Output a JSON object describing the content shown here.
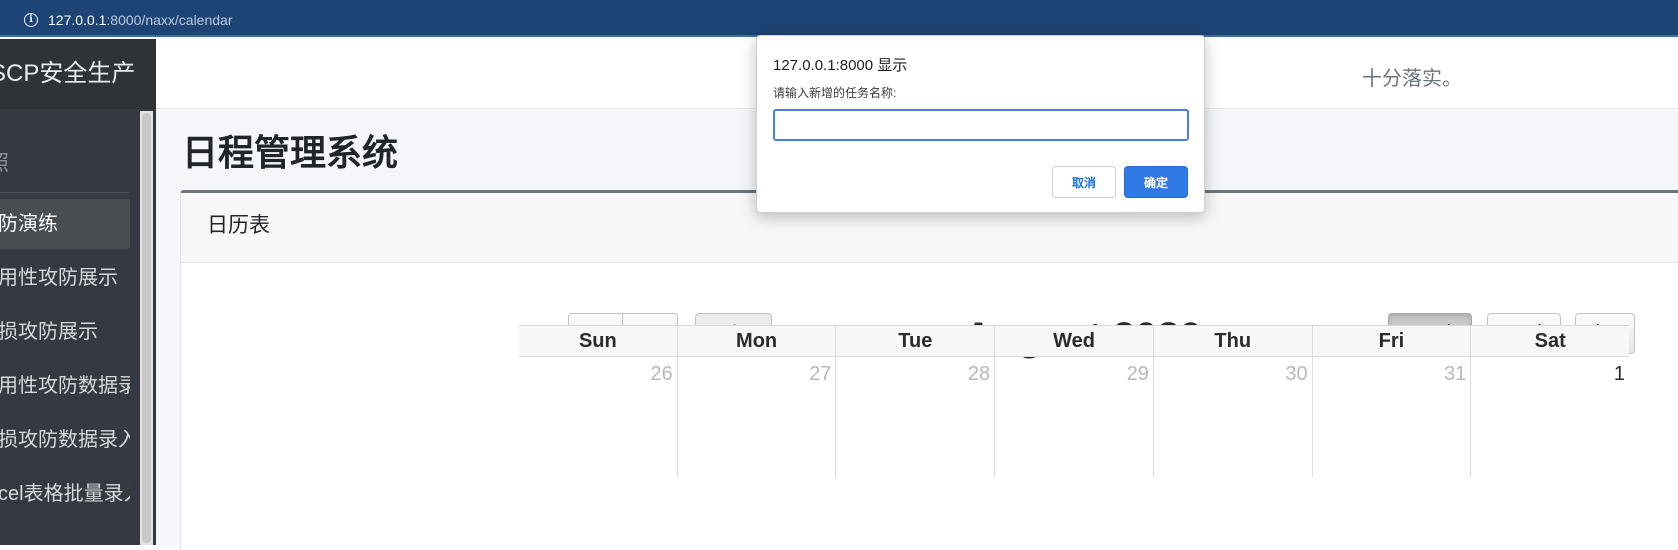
{
  "browser": {
    "url_host": "127.0.0.1",
    "url_rest": ":8000/naxx/calendar"
  },
  "sidebar": {
    "brand": "SCP安全生产",
    "user": "照",
    "items": [
      {
        "label": "防演练",
        "active": true
      },
      {
        "label": "用性攻防展示",
        "active": false
      },
      {
        "label": "损攻防展示",
        "active": false
      },
      {
        "label": "用性攻防数据录入",
        "active": false
      },
      {
        "label": "损攻防数据录入",
        "active": false
      },
      {
        "label": "cel表格批量录入",
        "active": false
      }
    ]
  },
  "topbar": {
    "marquee": "十分落实。"
  },
  "page": {
    "title": "日程管理系统",
    "card_title": "日历表"
  },
  "calendar": {
    "title": "August 2020",
    "today_label": "today",
    "views": [
      "month",
      "week",
      "day"
    ],
    "active_view": "month",
    "weekdays": [
      "Sun",
      "Mon",
      "Tue",
      "Wed",
      "Thu",
      "Fri",
      "Sat"
    ],
    "first_row": [
      "26",
      "27",
      "28",
      "29",
      "30",
      "31",
      "1"
    ]
  },
  "dialog": {
    "title": "127.0.0.1:8000 显示",
    "message": "请输入新增的任务名称:",
    "input_value": "",
    "cancel_label": "取消",
    "ok_label": "确定"
  },
  "colors": {
    "addressbar": "#1e4475",
    "sidebar": "#343a40",
    "primary_button": "#2f7ae5"
  }
}
